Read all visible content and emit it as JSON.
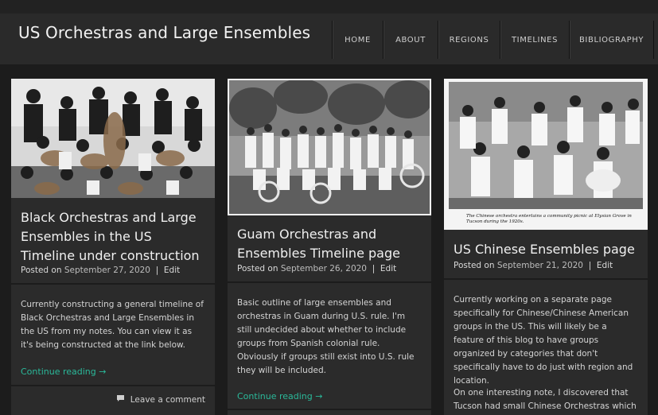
{
  "site": {
    "title": "US Orchestras and Large Ensembles"
  },
  "nav": [
    "HOME",
    "ABOUT",
    "REGIONS",
    "TIMELINES",
    "BIBLIOGRAPHY"
  ],
  "posts": [
    {
      "title": "Black Orchestras and Large Ensembles in the US Timeline under construction",
      "posted_on": "Posted on",
      "date": "September 27, 2020",
      "sep": "|",
      "edit": "Edit",
      "excerpt": "Currently constructing a general timeline of Black Orchestras and Large Ensembles in the US from my notes. You can view it as it's being constructed at the link below.",
      "continue": "Continue reading →",
      "comment": "Leave a comment"
    },
    {
      "title": "Guam Orchestras and Ensembles Timeline page",
      "posted_on": "Posted on",
      "date": "September 26, 2020",
      "sep": "|",
      "edit": "Edit",
      "excerpt": "Basic outline of large ensembles and orchestras in Guam during U.S. rule. I'm still undecided about whether to include groups from Spanish colonial rule. Obviously if groups still exist into U.S. rule they will be included.",
      "continue": "Continue reading →"
    },
    {
      "title": "US Chinese Ensembles page",
      "posted_on": "Posted on",
      "date": "September 21, 2020",
      "sep": "|",
      "edit": "Edit",
      "caption_line1": "The Chinese orchestra entertains a community picnic at Elysian Grove in",
      "caption_line2": "Tucson during the 1920s.",
      "excerpt": "Currently working on a separate page specifically for Chinese/Chinese American groups in the US. This will likely be a feature of this blog to have groups organized by categories that don't specifically have to do just with region and location.",
      "excerpt2": "On one interesting note, I discovered that Tucson had small Chinese Orchestras which"
    }
  ],
  "icons": {
    "comment": "speech-bubble-icon"
  },
  "colors": {
    "accent": "#2bb99a",
    "background": "#1c1c1c",
    "card": "#2b2b2b",
    "header": "#2a2a2a"
  }
}
